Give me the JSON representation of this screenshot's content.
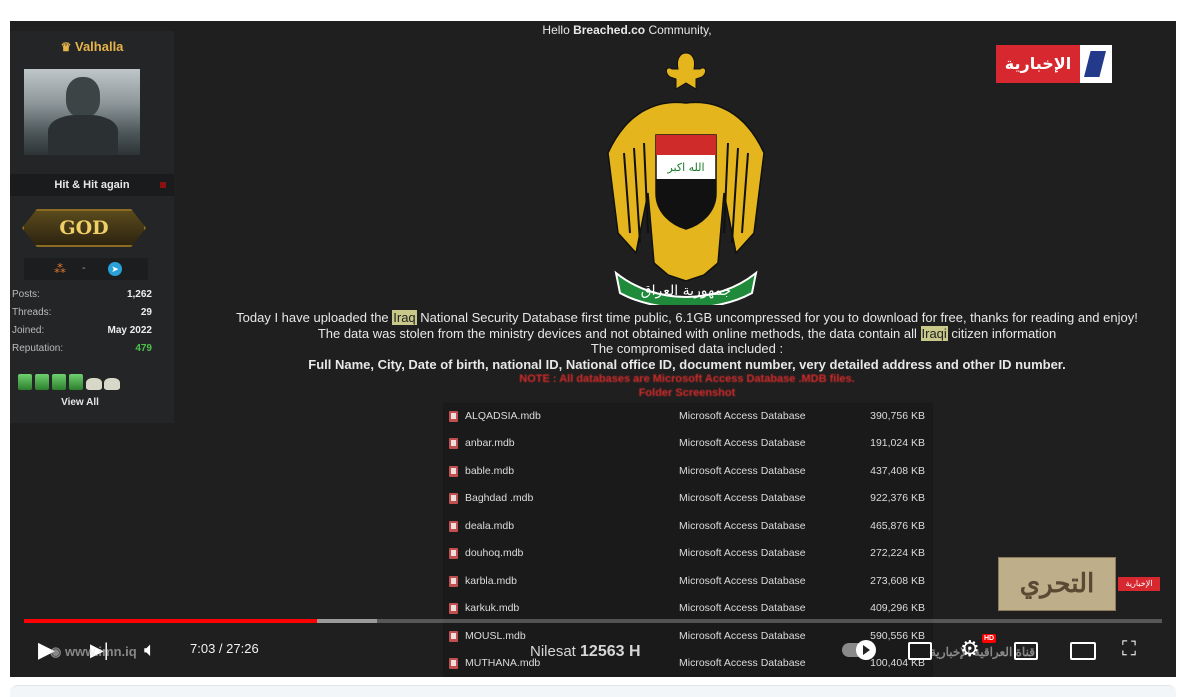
{
  "profile": {
    "username": "Valhalla",
    "usertitle": "Hit & Hit again",
    "rank": "GOD",
    "stats": [
      {
        "label": "Posts:",
        "value": "1,262"
      },
      {
        "label": "Threads:",
        "value": "29"
      },
      {
        "label": "Joined:",
        "value": "May 2022"
      },
      {
        "label": "Reputation:",
        "value": "479"
      }
    ],
    "view_all": "View All"
  },
  "post": {
    "greeting_prefix": "Hello ",
    "greeting_site": "Breached.co",
    "greeting_suffix": " Community,",
    "line1_a": "Today I have uploaded the ",
    "line1_hl": "Iraq",
    "line1_b": " National Security Database first time public, 6.1GB uncompressed for you to download for free, thanks for reading and enjoy!",
    "line2_a": "The data was stolen from the ministry devices and not obtained with online methods, the data contain all ",
    "line2_hl": "Iraqi",
    "line2_b": " citizen information",
    "line3": "The compromised data included :",
    "line4": "Full Name, City, Date of birth, national ID, National office ID, document number, very detailed address and other ID number.",
    "note": "NOTE : All databases are Microsoft Access Database .MDB files.",
    "folder": "Folder Screenshot",
    "emblem_text": "جمهورية العراق",
    "flag_text": "الله اكبر"
  },
  "files": [
    {
      "name": "ALQADSIA.mdb",
      "type": "Microsoft Access Database",
      "size": "390,756 KB"
    },
    {
      "name": "anbar.mdb",
      "type": "Microsoft Access Database",
      "size": "191,024 KB"
    },
    {
      "name": "bable.mdb",
      "type": "Microsoft Access Database",
      "size": "437,408 KB"
    },
    {
      "name": "Baghdad .mdb",
      "type": "Microsoft Access Database",
      "size": "922,376 KB"
    },
    {
      "name": "deala.mdb",
      "type": "Microsoft Access Database",
      "size": "465,876 KB"
    },
    {
      "name": "douhoq.mdb",
      "type": "Microsoft Access Database",
      "size": "272,224 KB"
    },
    {
      "name": "karbla.mdb",
      "type": "Microsoft Access Database",
      "size": "273,608 KB"
    },
    {
      "name": "karkuk.mdb",
      "type": "Microsoft Access Database",
      "size": "409,296 KB"
    },
    {
      "name": "MOUSL.mdb",
      "type": "Microsoft Access Database",
      "size": "590,556 KB"
    },
    {
      "name": "MUTHANA.mdb",
      "type": "Microsoft Access Database",
      "size": "100,404 KB"
    }
  ],
  "channel": {
    "logo_text": "الإخبارية",
    "program_text": "التحري",
    "watermark_url": "www.imn.iq",
    "satellite_label": "Nilesat",
    "satellite_freq": "12563 H",
    "bottom_ticker": "قناة العراقية الإخبارية"
  },
  "player": {
    "current_time": "7:03",
    "duration": "27:26",
    "time_separator": " / ",
    "progress_played": 0.2575,
    "progress_loaded": 0.31,
    "hd_badge": "HD",
    "colors": {
      "progress": "#ff0000",
      "logo_red": "#d7282f"
    },
    "icons": [
      "play-icon",
      "next-icon",
      "volume-icon",
      "autoplay-toggle",
      "subtitles-icon",
      "settings-icon",
      "miniplayer-icon",
      "theater-icon",
      "fullscreen-icon"
    ]
  }
}
